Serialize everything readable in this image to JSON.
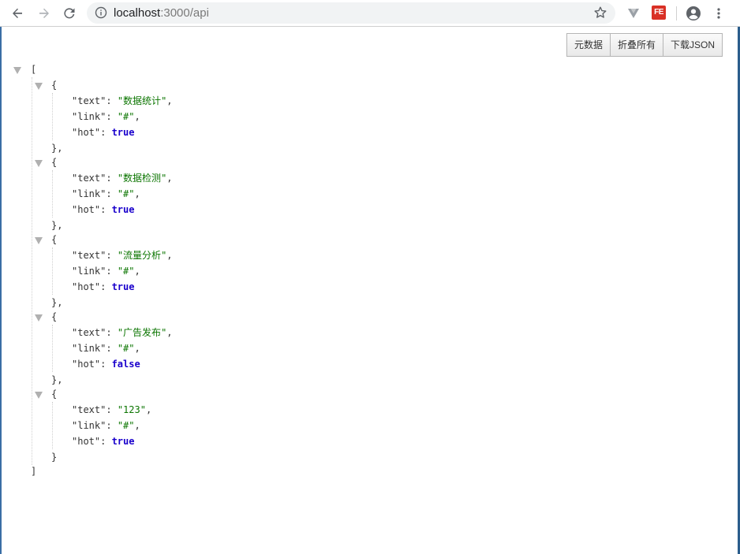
{
  "browser": {
    "url_host": "localhost",
    "url_path": ":3000/api",
    "extension_label": "FE"
  },
  "viewer": {
    "buttons": [
      "元数据",
      "折叠所有",
      "下载JSON"
    ]
  },
  "json": {
    "open_bracket": "[",
    "close_bracket": "]",
    "items": [
      {
        "text": "数据统计",
        "link": "#",
        "hot": "true"
      },
      {
        "text": "数据检测",
        "link": "#",
        "hot": "true"
      },
      {
        "text": "流量分析",
        "link": "#",
        "hot": "true"
      },
      {
        "text": "广告发布",
        "link": "#",
        "hot": "false"
      },
      {
        "text": "123",
        "link": "#",
        "hot": "true"
      }
    ]
  }
}
